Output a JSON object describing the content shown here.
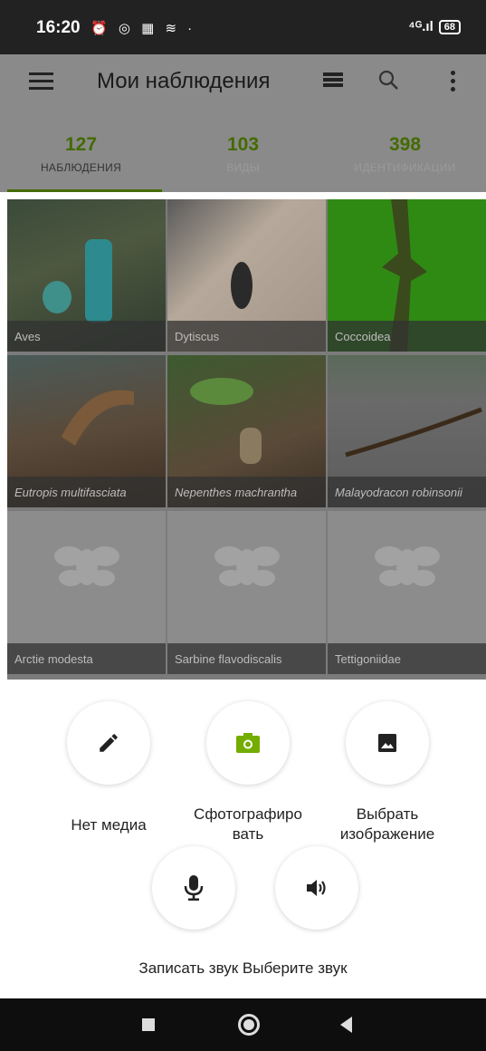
{
  "status": {
    "time": "16:20",
    "icons": "⏰ ◎ ▦ ≋ ·",
    "signal": "⁴ᴳ.ıl",
    "battery": "68"
  },
  "toolbar": {
    "title": "Мои наблюдения"
  },
  "tabs": [
    {
      "count": "127",
      "label": "НАБЛЮДЕНИЯ"
    },
    {
      "count": "103",
      "label": "ВИДЫ"
    },
    {
      "count": "398",
      "label": "ИДЕНТИФИКАЦИИ"
    }
  ],
  "grid": [
    {
      "caption": "Aves"
    },
    {
      "caption": "Dytiscus"
    },
    {
      "caption": "Coccoidea"
    },
    {
      "caption": "Eutropis multifasciata"
    },
    {
      "caption": "Nepenthes machrantha"
    },
    {
      "caption": "Malayodracon robinsonii"
    },
    {
      "caption": "Arctie modesta"
    },
    {
      "caption": "Sarbine flavodiscalis"
    },
    {
      "caption": "Tettigoniidae"
    }
  ],
  "options": {
    "no_media": "Нет медиа",
    "take_photo_line1": "Сфотографиро",
    "take_photo_line2": "вать",
    "choose_image_line1": "Выбрать",
    "choose_image_line2": "изображение",
    "record_sound_select": "Записать звук Выберите звук"
  },
  "colors": {
    "accent": "#74ac00",
    "overlay": "#8a8a8a"
  }
}
